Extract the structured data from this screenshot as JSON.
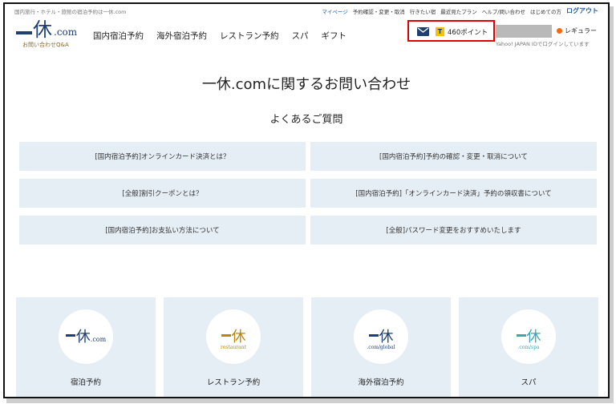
{
  "topbar": {
    "tagline": "国内旅行・ホテル・旅館の宿泊予約は一休.com",
    "links": [
      "マイページ",
      "予約確認・変更・取消",
      "行きたい宿",
      "最近見たプラン",
      "ヘルプ/問い合わせ",
      "はじめての方"
    ],
    "logout": "ログアウト"
  },
  "logo": {
    "main": "休",
    "com": ".com",
    "sub": "お問い合わせQ&A"
  },
  "nav": [
    "国内宿泊予約",
    "海外宿泊予約",
    "レストラン予約",
    "スパ",
    "ギフト"
  ],
  "account": {
    "points": "460ポイント",
    "tpoint_mark": "T",
    "member_rank": "レギュラー",
    "login_note": "Yahoo! JAPAN IDでログインしています"
  },
  "page": {
    "title": "一休.comに関するお問い合わせ",
    "faq_heading": "よくあるご質問"
  },
  "faq_items": [
    "[国内宿泊予約]オンラインカード決済とは？",
    "[国内宿泊予約]予約の確認・変更・取消について",
    "[全般]割引クーポンとは？",
    "[国内宿泊予約]「オンラインカード決済」予約の領収書について",
    "[国内宿泊予約]お支払い方法について",
    "[全般]パスワード変更をおすすめいたします"
  ],
  "categories": [
    {
      "label": "宿泊予約",
      "mark": "休",
      "mark_sub": ".com",
      "color": "#1e3f70"
    },
    {
      "label": "レストラン予約",
      "mark": "休",
      "mark_sub": "restaurant",
      "color": "#b8860b"
    },
    {
      "label": "海外宿泊予約",
      "mark": "休",
      "mark_sub": ".com/global",
      "color": "#1e3f70"
    },
    {
      "label": "スパ",
      "mark": "休",
      "mark_sub": ".com/spa",
      "color": "#3aa6b0"
    }
  ]
}
